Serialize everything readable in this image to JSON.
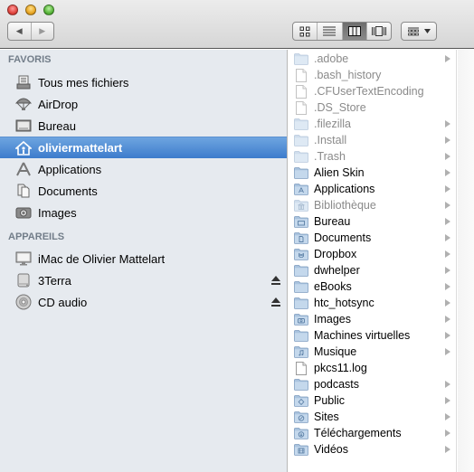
{
  "window": {
    "traffic_lights": [
      "close",
      "minimize",
      "zoom"
    ]
  },
  "toolbar": {
    "nav": {
      "back_icon": "back-arrow-icon",
      "forward_icon": "forward-arrow-icon"
    },
    "view_modes": [
      {
        "name": "icon-view",
        "icon": "grid-icon",
        "active": false
      },
      {
        "name": "list-view",
        "icon": "list-icon",
        "active": false
      },
      {
        "name": "column-view",
        "icon": "columns-icon",
        "active": true
      },
      {
        "name": "coverflow-view",
        "icon": "coverflow-icon",
        "active": false
      }
    ],
    "arrange": {
      "icon": "arrange-grid-icon",
      "dropdown_icon": "chevron-down-icon"
    }
  },
  "sidebar": {
    "sections": [
      {
        "title": "FAVORIS",
        "items": [
          {
            "label": "Tous mes fichiers",
            "icon": "all-files-icon",
            "selected": false
          },
          {
            "label": "AirDrop",
            "icon": "airdrop-icon",
            "selected": false
          },
          {
            "label": "Bureau",
            "icon": "desktop-icon",
            "selected": false
          },
          {
            "label": "oliviermattelart",
            "icon": "home-icon",
            "selected": true
          },
          {
            "label": "Applications",
            "icon": "applications-icon",
            "selected": false
          },
          {
            "label": "Documents",
            "icon": "documents-icon",
            "selected": false
          },
          {
            "label": "Images",
            "icon": "camera-icon",
            "selected": false
          }
        ]
      },
      {
        "title": "APPAREILS",
        "items": [
          {
            "label": "iMac de Olivier Mattelart",
            "icon": "imac-icon",
            "eject": false
          },
          {
            "label": "3Terra",
            "icon": "hard-drive-icon",
            "eject": true
          },
          {
            "label": "CD audio",
            "icon": "cd-icon",
            "eject": true
          }
        ]
      }
    ]
  },
  "column": {
    "items": [
      {
        "name": ".adobe",
        "type": "folder",
        "hidden": true,
        "has_children": true
      },
      {
        "name": ".bash_history",
        "type": "file",
        "hidden": true,
        "has_children": false
      },
      {
        "name": ".CFUserTextEncoding",
        "type": "file",
        "hidden": true,
        "has_children": false
      },
      {
        "name": ".DS_Store",
        "type": "file",
        "hidden": true,
        "has_children": false
      },
      {
        "name": ".filezilla",
        "type": "folder",
        "hidden": true,
        "has_children": true
      },
      {
        "name": ".Install",
        "type": "folder",
        "hidden": true,
        "has_children": true
      },
      {
        "name": ".Trash",
        "type": "folder",
        "hidden": true,
        "has_children": true
      },
      {
        "name": "Alien Skin",
        "type": "folder",
        "hidden": false,
        "has_children": true
      },
      {
        "name": "Applications",
        "type": "folder-apps",
        "hidden": false,
        "has_children": true
      },
      {
        "name": "Bibliothèque",
        "type": "folder-library",
        "hidden": true,
        "has_children": true
      },
      {
        "name": "Bureau",
        "type": "folder-desktop",
        "hidden": false,
        "has_children": true
      },
      {
        "name": "Documents",
        "type": "folder-documents",
        "hidden": false,
        "has_children": true
      },
      {
        "name": "Dropbox",
        "type": "folder-dropbox",
        "hidden": false,
        "has_children": true
      },
      {
        "name": "dwhelper",
        "type": "folder",
        "hidden": false,
        "has_children": true
      },
      {
        "name": "eBooks",
        "type": "folder",
        "hidden": false,
        "has_children": true
      },
      {
        "name": "htc_hotsync",
        "type": "folder",
        "hidden": false,
        "has_children": true
      },
      {
        "name": "Images",
        "type": "folder-pictures",
        "hidden": false,
        "has_children": true
      },
      {
        "name": "Machines virtuelles",
        "type": "folder",
        "hidden": false,
        "has_children": true
      },
      {
        "name": "Musique",
        "type": "folder-music",
        "hidden": false,
        "has_children": true
      },
      {
        "name": "pkcs11.log",
        "type": "file",
        "hidden": false,
        "has_children": false
      },
      {
        "name": "podcasts",
        "type": "folder",
        "hidden": false,
        "has_children": true
      },
      {
        "name": "Public",
        "type": "folder-public",
        "hidden": false,
        "has_children": true
      },
      {
        "name": "Sites",
        "type": "folder-sites",
        "hidden": false,
        "has_children": true
      },
      {
        "name": "Téléchargements",
        "type": "folder-downloads",
        "hidden": false,
        "has_children": true
      },
      {
        "name": "Vidéos",
        "type": "folder-movies",
        "hidden": false,
        "has_children": true
      }
    ]
  }
}
